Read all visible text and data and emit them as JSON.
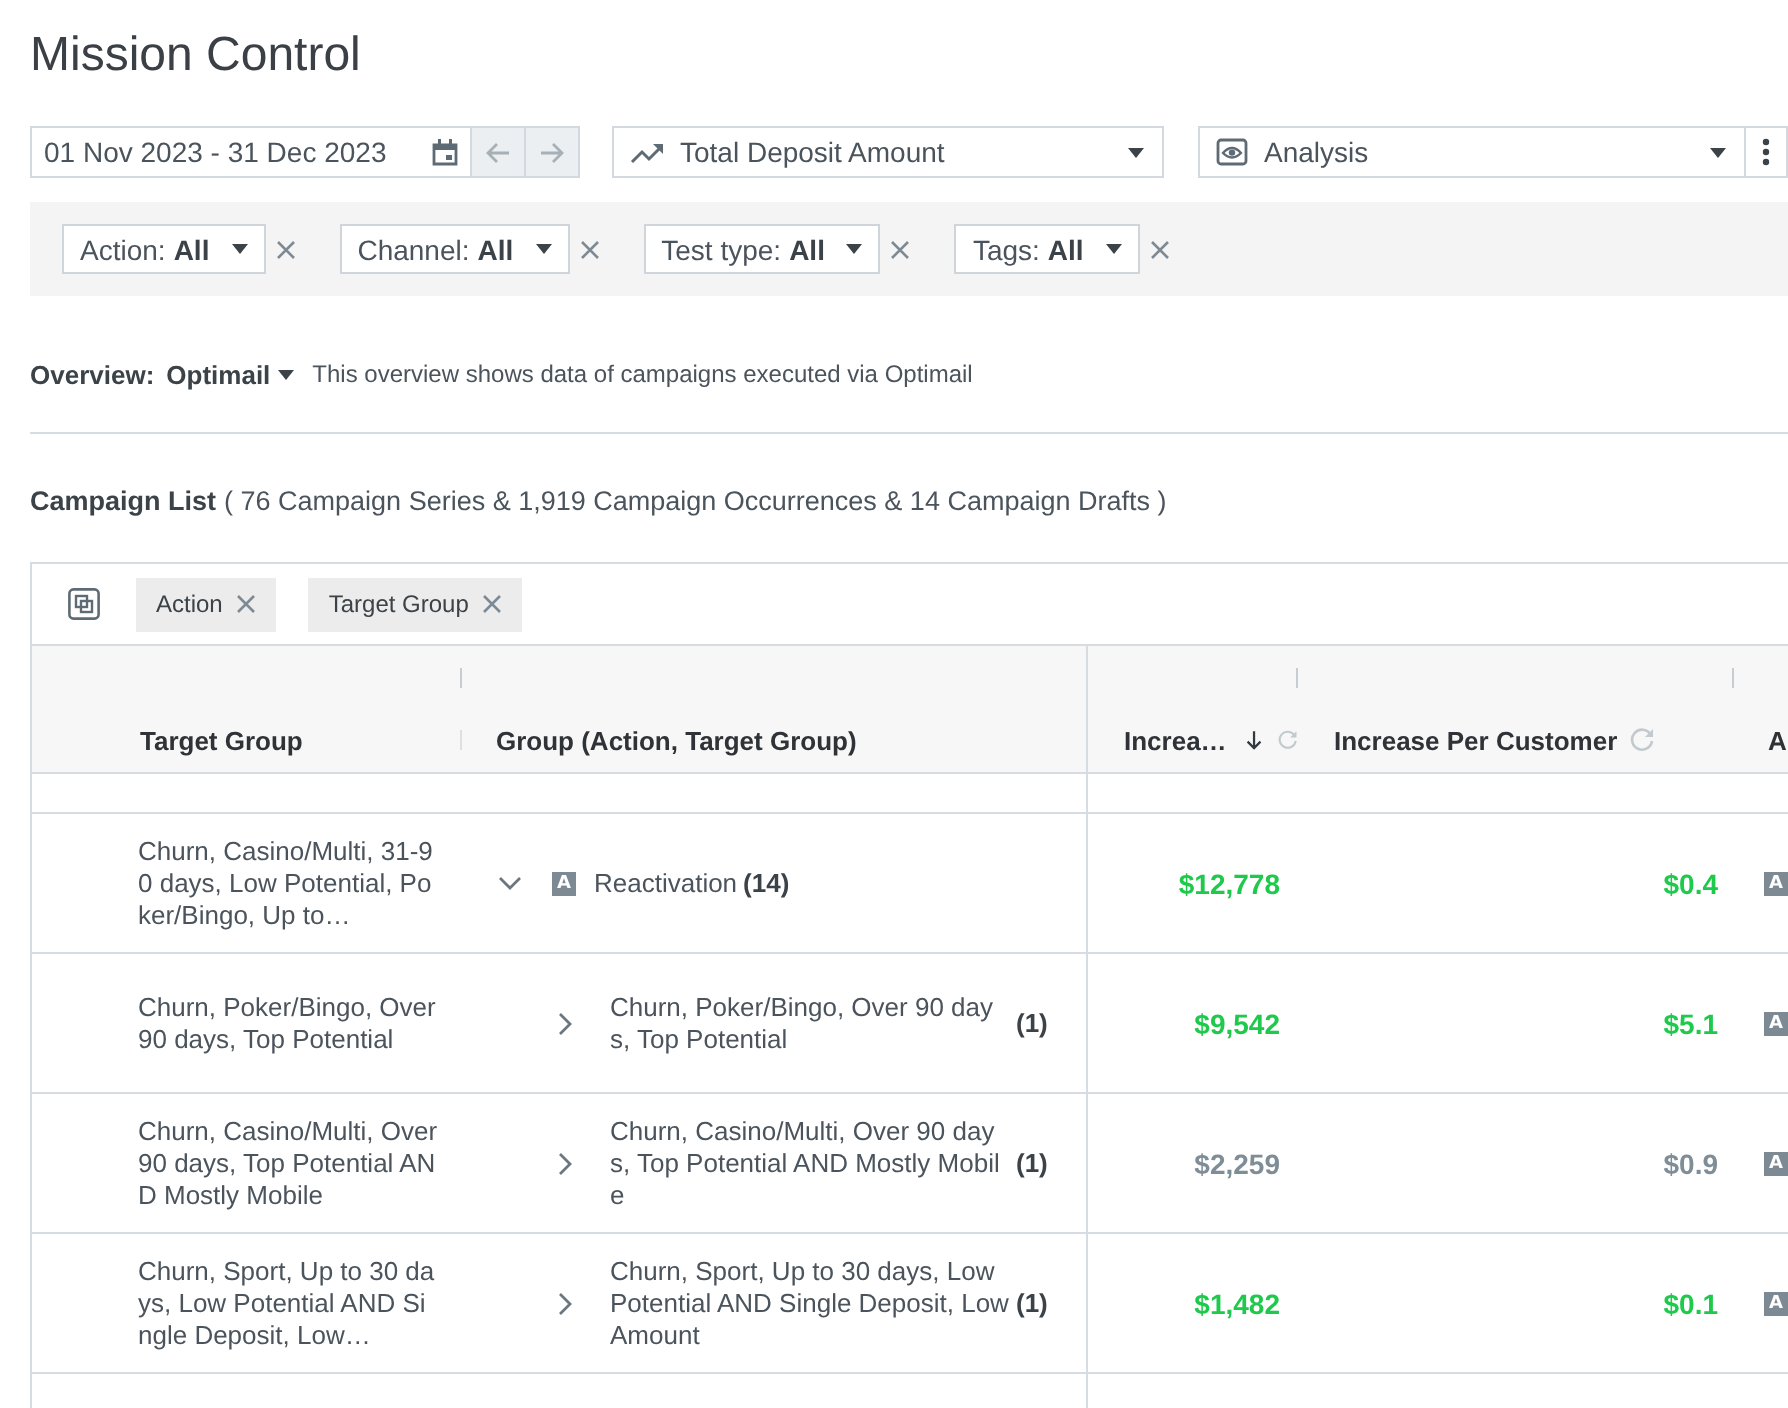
{
  "page_title": "Mission Control",
  "toolbar": {
    "date_range": "01 Nov 2023 - 31 Dec 2023",
    "metric": "Total Deposit Amount",
    "view": "Analysis"
  },
  "filters": [
    {
      "label": "Action:",
      "value": "All"
    },
    {
      "label": "Channel:",
      "value": "All"
    },
    {
      "label": "Test type:",
      "value": "All"
    },
    {
      "label": "Tags:",
      "value": "All"
    }
  ],
  "overview": {
    "label": "Overview:",
    "value": "Optimail",
    "description": "This overview shows data of campaigns executed via Optimail"
  },
  "campaign_list": {
    "title": "Campaign List",
    "summary": "( 76 Campaign Series & 1,919 Campaign Occurrences & 14 Campaign Drafts )"
  },
  "table": {
    "group_by": [
      "Action",
      "Target Group"
    ],
    "columns": [
      {
        "label": "Target Group",
        "kind": "text",
        "sorted": false
      },
      {
        "label": "Group (Action, Target Group)",
        "kind": "text",
        "sorted": false
      },
      {
        "label": "Increa…",
        "kind": "metric",
        "sorted": true
      },
      {
        "label": "Increase Per Customer",
        "kind": "metric",
        "sorted": false
      },
      {
        "label": "A",
        "kind": "text",
        "sorted": false
      }
    ],
    "rows": [
      {
        "kind": "group",
        "target_group": "Churn, Casino/Multi, 31-90 days, Low Potential, Poker/Bingo, Up to…",
        "badge": "A",
        "name": "Reactivation",
        "count": "(14)",
        "expanded": true,
        "increase": "$12,778",
        "increase_per_customer": "$0.4",
        "significant": true,
        "column_5": "A",
        "children": [
          {
            "kind": "item",
            "target_group": "Churn, Poker/Bingo, Over 90 days, Top Potential",
            "name": "Churn, Poker/Bingo, Over 90 days, Top Potential",
            "count": "(1)",
            "expanded": false,
            "increase": "$9,542",
            "increase_per_customer": "$5.1",
            "significant": true,
            "column_5": "A"
          },
          {
            "kind": "item",
            "target_group": "Churn, Casino/Multi, Over 90 days, Top Potential AND Mostly Mobile",
            "name": "Churn, Casino/Multi, Over 90 days, Top Potential AND Mostly Mobile",
            "count": "(1)",
            "expanded": false,
            "increase": "$2,259",
            "increase_per_customer": "$0.9",
            "significant": false,
            "column_5": "A"
          },
          {
            "kind": "item",
            "target_group": "Churn, Sport, Up to 30 days, Low Potential AND Single Deposit, Low…",
            "name": "Churn, Sport, Up to 30 days, Low Potential AND Single Deposit, Low Amount",
            "count": "(1)",
            "expanded": false,
            "increase": "$1,482",
            "increase_per_customer": "$0.1",
            "significant": true,
            "column_5": "A"
          }
        ]
      }
    ]
  }
}
